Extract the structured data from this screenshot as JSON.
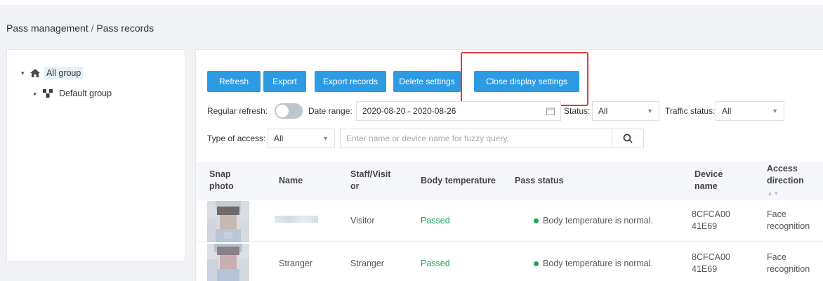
{
  "breadcrumb": {
    "section": "Pass management",
    "separator": "/",
    "page": "Pass records"
  },
  "tree": {
    "root": {
      "label": "All group",
      "icon": "home-icon"
    },
    "child": {
      "label": "Default group",
      "icon": "group-icon"
    }
  },
  "toolbar": {
    "refresh": "Refresh",
    "export": "Export",
    "export_records": "Export records",
    "delete_settings": "Delete settings",
    "close_display_settings": "Close display settings"
  },
  "filters": {
    "regular_refresh_label": "Regular refresh:",
    "date_range_label": "Date range:",
    "date_range_value": "2020-08-20 - 2020-08-26",
    "status_label": "Status:",
    "status_value": "All",
    "traffic_status_label": "Traffic status:",
    "traffic_status_value": "All",
    "type_of_access_label": "Type of access:",
    "type_of_access_value": "All",
    "search_placeholder": "Enter name or device name for fuzzy query."
  },
  "table": {
    "headers": {
      "snap_photo": "Snap photo",
      "name": "Name",
      "staff_visitor": "Staff/Visitor",
      "body_temperature": "Body temperature",
      "pass_status": "Pass status",
      "device_name": "Device name",
      "access_direction": "Access direction"
    },
    "rows": [
      {
        "name": "",
        "staff_visitor": "Visitor",
        "body_temperature": "Passed",
        "pass_status": "Body temperature is normal.",
        "device_name": "8CFCA0041E69",
        "access_direction": "Face recognition"
      },
      {
        "name": "Stranger",
        "staff_visitor": "Stranger",
        "body_temperature": "Passed",
        "pass_status": "Body temperature is normal.",
        "device_name": "8CFCA0041E69",
        "access_direction": "Face recognition"
      }
    ]
  },
  "colors": {
    "primary": "#2d9be4",
    "highlight": "#e8383d",
    "success": "#19a85a"
  }
}
